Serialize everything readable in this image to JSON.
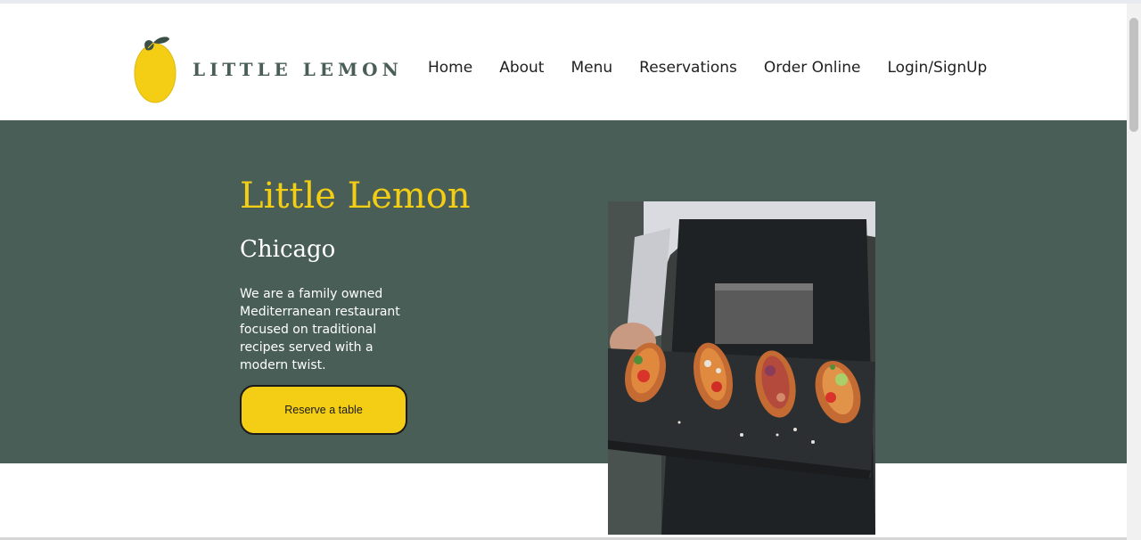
{
  "brand": {
    "name": "LITTLE LEMON",
    "logo_icon": "lemon-icon",
    "accent_yellow": "#f4ce14",
    "primary_green": "#495e57"
  },
  "nav": {
    "items": [
      {
        "label": "Home"
      },
      {
        "label": "About"
      },
      {
        "label": "Menu"
      },
      {
        "label": "Reservations"
      },
      {
        "label": "Order Online"
      },
      {
        "label": "Login/SignUp"
      }
    ]
  },
  "hero": {
    "title": "Little Lemon",
    "subtitle": "Chicago",
    "description": "We are a family owned Mediterranean restaurant focused on traditional recipes served with a modern twist.",
    "button_label": "Reserve a table",
    "image_icon": "food-photo-bruschetta"
  }
}
